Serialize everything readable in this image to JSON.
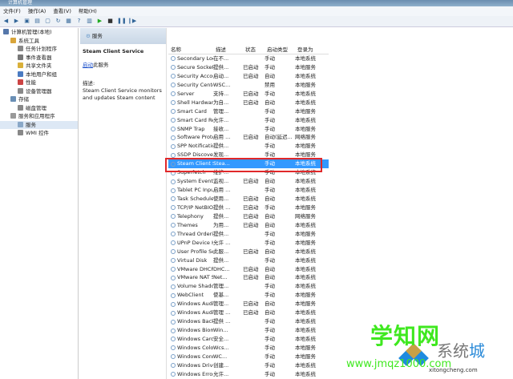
{
  "window": {
    "title": "计算机管理"
  },
  "menu": [
    "文件(F)",
    "操作(A)",
    "查看(V)",
    "帮助(H)"
  ],
  "toolbar": [
    "back",
    "forward",
    "up",
    "console",
    "properties",
    "refresh",
    "export",
    "help",
    "view",
    "play",
    "stop",
    "pause",
    "resume"
  ],
  "tree": [
    {
      "label": "计算机管理(本地)",
      "level": 0,
      "color": "#5577aa"
    },
    {
      "label": "系统工具",
      "level": 1,
      "color": "#d9a53a"
    },
    {
      "label": "任务计划程序",
      "level": 2,
      "color": "#888"
    },
    {
      "label": "事件查看器",
      "level": 2,
      "color": "#777"
    },
    {
      "label": "共享文件夹",
      "level": 2,
      "color": "#d9b03a"
    },
    {
      "label": "本地用户和组",
      "level": 2,
      "color": "#4a7bc2"
    },
    {
      "label": "性能",
      "level": 2,
      "color": "#c44"
    },
    {
      "label": "设备管理器",
      "level": 2,
      "color": "#888"
    },
    {
      "label": "存储",
      "level": 1,
      "color": "#6a8fb5"
    },
    {
      "label": "磁盘管理",
      "level": 2,
      "color": "#888"
    },
    {
      "label": "服务和应用程序",
      "level": 1,
      "color": "#999"
    },
    {
      "label": "服务",
      "level": 2,
      "color": "#8aa8c8"
    },
    {
      "label": "WMI 控件",
      "level": 2,
      "color": "#888"
    }
  ],
  "mid": {
    "header": "服务",
    "service_name": "Steam Client Service",
    "start_link": "启动",
    "start_suffix": "此服务",
    "desc_label": "描述:",
    "description": "Steam Client Service monitors and updates Steam content"
  },
  "columns": [
    "名称",
    "描述",
    "状态",
    "启动类型",
    "登录为"
  ],
  "services": [
    [
      "Secondary Logon",
      "在不...",
      "",
      "手动",
      "本地系统"
    ],
    [
      "Secure Socket T...",
      "提供...",
      "已启动",
      "手动",
      "本地服务"
    ],
    [
      "Security Account...",
      "启动...",
      "已启动",
      "自动",
      "本地系统"
    ],
    [
      "Security Center",
      "WSC...",
      "",
      "禁用",
      "本地服务"
    ],
    [
      "Server",
      "支持...",
      "已启动",
      "手动",
      "本地系统"
    ],
    [
      "Shell Hardware ...",
      "为自...",
      "已启动",
      "自动",
      "本地系统"
    ],
    [
      "Smart Card",
      "管理...",
      "",
      "手动",
      "本地服务"
    ],
    [
      "Smart Card Rem...",
      "允许...",
      "",
      "手动",
      "本地系统"
    ],
    [
      "SNMP Trap",
      "接收...",
      "",
      "手动",
      "本地服务"
    ],
    [
      "Software Protect...",
      "启用 ...",
      "已启动",
      "自动(延迟...",
      "网络服务"
    ],
    [
      "SPP Notification ...",
      "提供...",
      "",
      "手动",
      "本地服务"
    ],
    [
      "SSDP Discovery",
      "发现...",
      "",
      "手动",
      "本地服务"
    ],
    [
      "Steam Client Ser...",
      "Stea...",
      "",
      "手动",
      "本地系统"
    ],
    [
      "Superfetch",
      "维护...",
      "",
      "手动",
      "本地系统"
    ],
    [
      "System Event N...",
      "监视...",
      "已启动",
      "自动",
      "本地系统"
    ],
    [
      "Tablet PC Input ...",
      "启用 ...",
      "",
      "手动",
      "本地系统"
    ],
    [
      "Task Scheduler",
      "使用...",
      "已启动",
      "自动",
      "本地系统"
    ],
    [
      "TCP/IP NetBIOS ...",
      "提供 ...",
      "已启动",
      "手动",
      "本地服务"
    ],
    [
      "Telephony",
      "提供...",
      "已启动",
      "自动",
      "网络服务"
    ],
    [
      "Themes",
      "为用...",
      "已启动",
      "自动",
      "本地系统"
    ],
    [
      "Thread Orderin...",
      "提供...",
      "",
      "手动",
      "本地服务"
    ],
    [
      "UPnP Device Host",
      "允许 ...",
      "",
      "手动",
      "本地服务"
    ],
    [
      "User Profile Serv...",
      "此服...",
      "已启动",
      "自动",
      "本地系统"
    ],
    [
      "Virtual Disk",
      "提供...",
      "",
      "手动",
      "本地系统"
    ],
    [
      "VMware DHCP S...",
      "DHC...",
      "已启动",
      "自动",
      "本地系统"
    ],
    [
      "VMware NAT Se...",
      "Net...",
      "已启动",
      "自动",
      "本地系统"
    ],
    [
      "Volume Shadow...",
      "管理...",
      "",
      "手动",
      "本地系统"
    ],
    [
      "WebClient",
      "使基...",
      "",
      "手动",
      "本地服务"
    ],
    [
      "Windows Audio",
      "管理...",
      "已启动",
      "自动",
      "本地服务"
    ],
    [
      "Windows Audio ...",
      "管理 ...",
      "已启动",
      "自动",
      "本地系统"
    ],
    [
      "Windows Backup",
      "提供 ...",
      "",
      "手动",
      "本地系统"
    ],
    [
      "Windows Biome...",
      "Win...",
      "",
      "手动",
      "本地系统"
    ],
    [
      "Windows CardS...",
      "安全...",
      "",
      "手动",
      "本地系统"
    ],
    [
      "Windows Color ...",
      "Wcs...",
      "",
      "手动",
      "本地服务"
    ],
    [
      "Windows Conne...",
      "WC...",
      "",
      "手动",
      "本地服务"
    ],
    [
      "Windows Driver ...",
      "创建...",
      "",
      "手动",
      "本地系统"
    ],
    [
      "Windows Error ...",
      "允许...",
      "",
      "手动",
      "本地系统"
    ]
  ],
  "selected_index": 12,
  "watermark": {
    "brand1": "学知网",
    "url1": "www.jmqz1000.com",
    "brand2a": "系统",
    "brand2b": "城",
    "url2": "xitongcheng.com"
  }
}
